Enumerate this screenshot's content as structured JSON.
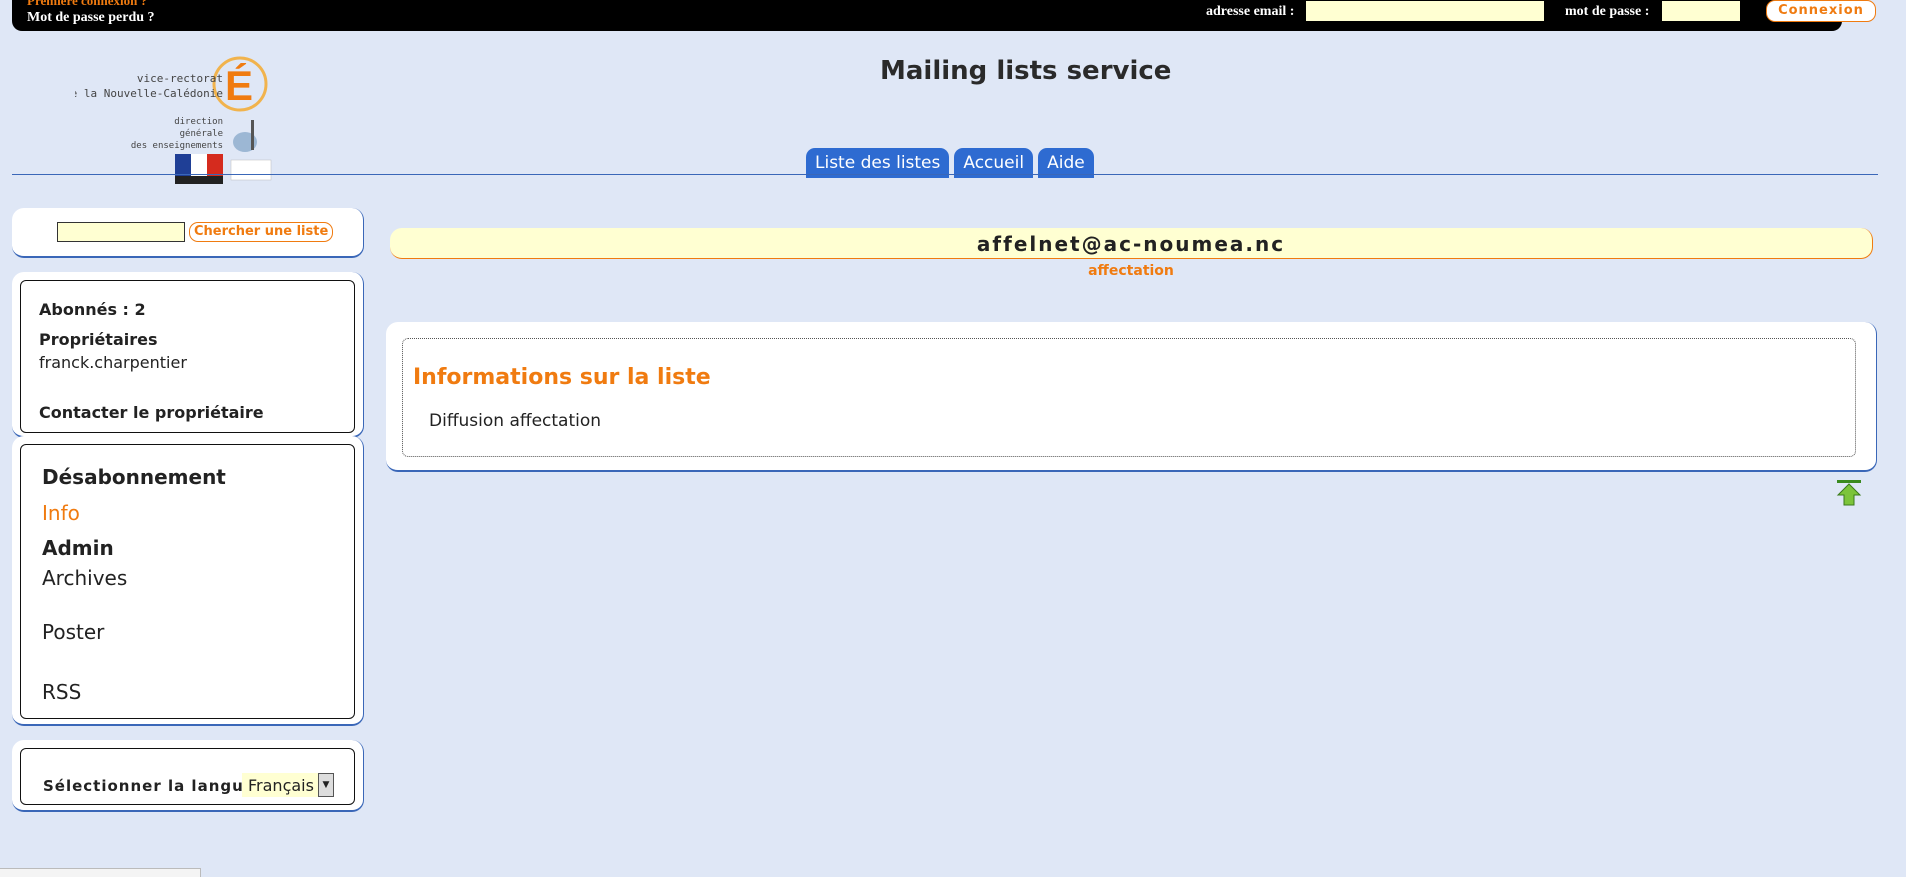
{
  "topbar": {
    "first_login": "Première connexion ?",
    "lost_password": "Mot de passe perdu ?",
    "email_label": "adresse email :",
    "email_value": "",
    "password_label": "mot de passe :",
    "password_value": "",
    "login_button": "Connexion"
  },
  "logo": {
    "line1": "vice-rectorat",
    "line2": "de la Nouvelle-Calédonie",
    "line3": "direction",
    "line4": "générale",
    "line5": "des enseignements"
  },
  "header": {
    "title": "Mailing lists service",
    "tabs": [
      {
        "label": "Liste des listes"
      },
      {
        "label": "Accueil"
      },
      {
        "label": "Aide"
      }
    ]
  },
  "search": {
    "value": "",
    "button": "Chercher une liste"
  },
  "list_info": {
    "subscribers": "Abonnés : 2",
    "owners_heading": "Propriétaires",
    "owner": "franck.charpentier",
    "contact": "Contacter le propriétaire"
  },
  "menu": {
    "items": [
      {
        "label": "Désabonnement"
      },
      {
        "label": "Info"
      },
      {
        "label": "Admin"
      },
      {
        "label": "Archives"
      },
      {
        "label": "Poster"
      },
      {
        "label": "RSS"
      }
    ]
  },
  "language": {
    "label": "Sélectionner la langue",
    "selected": "Français"
  },
  "main": {
    "list_address": "affelnet@ac-noumea.nc",
    "list_subject": "affectation",
    "section_title": "Informations sur la liste",
    "description": "Diffusion affectation"
  },
  "colors": {
    "background": "#dfe7f6",
    "accent": "#f07b10",
    "tab_blue": "#2e6bd1",
    "input_yellow": "#ffffd2"
  }
}
